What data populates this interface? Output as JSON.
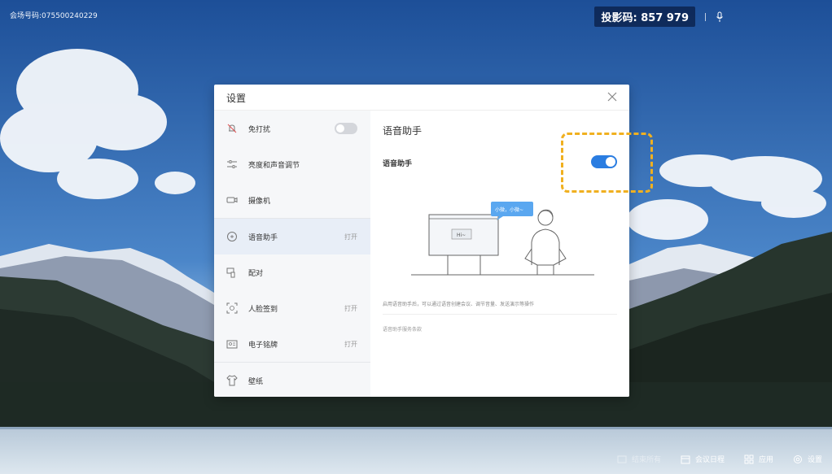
{
  "top_bar": {
    "meeting_id": "会场号码:075500240229",
    "projection_code": "投影码: 857 979"
  },
  "dialog": {
    "title": "设置",
    "sidebar": {
      "items": [
        {
          "label": "免打扰",
          "status": "",
          "icon": "bell-off-icon",
          "toggle": false
        },
        {
          "label": "亮度和声音调节",
          "status": "",
          "icon": "sliders-icon"
        },
        {
          "label": "摄像机",
          "status": "",
          "icon": "camera-icon"
        },
        {
          "label": "语音助手",
          "status": "打开",
          "icon": "voice-icon",
          "active": true
        },
        {
          "label": "配对",
          "status": "",
          "icon": "pair-icon"
        },
        {
          "label": "人脸签到",
          "status": "打开",
          "icon": "face-scan-icon"
        },
        {
          "label": "电子铭牌",
          "status": "打开",
          "icon": "nameplate-icon"
        },
        {
          "label": "壁纸",
          "status": "",
          "icon": "shirt-icon"
        }
      ]
    },
    "content": {
      "title": "语音助手",
      "toggle_label": "语音助手",
      "toggle_on": true,
      "bubble_text": "小微，小微~",
      "screen_text": "Hi~",
      "description": "启用语音助手后，可以通过语音创建会议、调节音量、发送演示等操作",
      "terms_link": "语音助手服务条款"
    }
  },
  "bottom_bar": {
    "items": [
      {
        "label": "结束所有",
        "icon": "end-icon",
        "enabled": false
      },
      {
        "label": "会议日程",
        "icon": "calendar-icon",
        "enabled": true
      },
      {
        "label": "应用",
        "icon": "apps-icon",
        "enabled": true
      },
      {
        "label": "设置",
        "icon": "gear-icon",
        "enabled": true
      }
    ]
  },
  "colors": {
    "accent": "#2a7de1",
    "highlight": "#f0b020",
    "sidebar_bg": "#f6f7f9",
    "active_bg": "#e8eef7"
  }
}
